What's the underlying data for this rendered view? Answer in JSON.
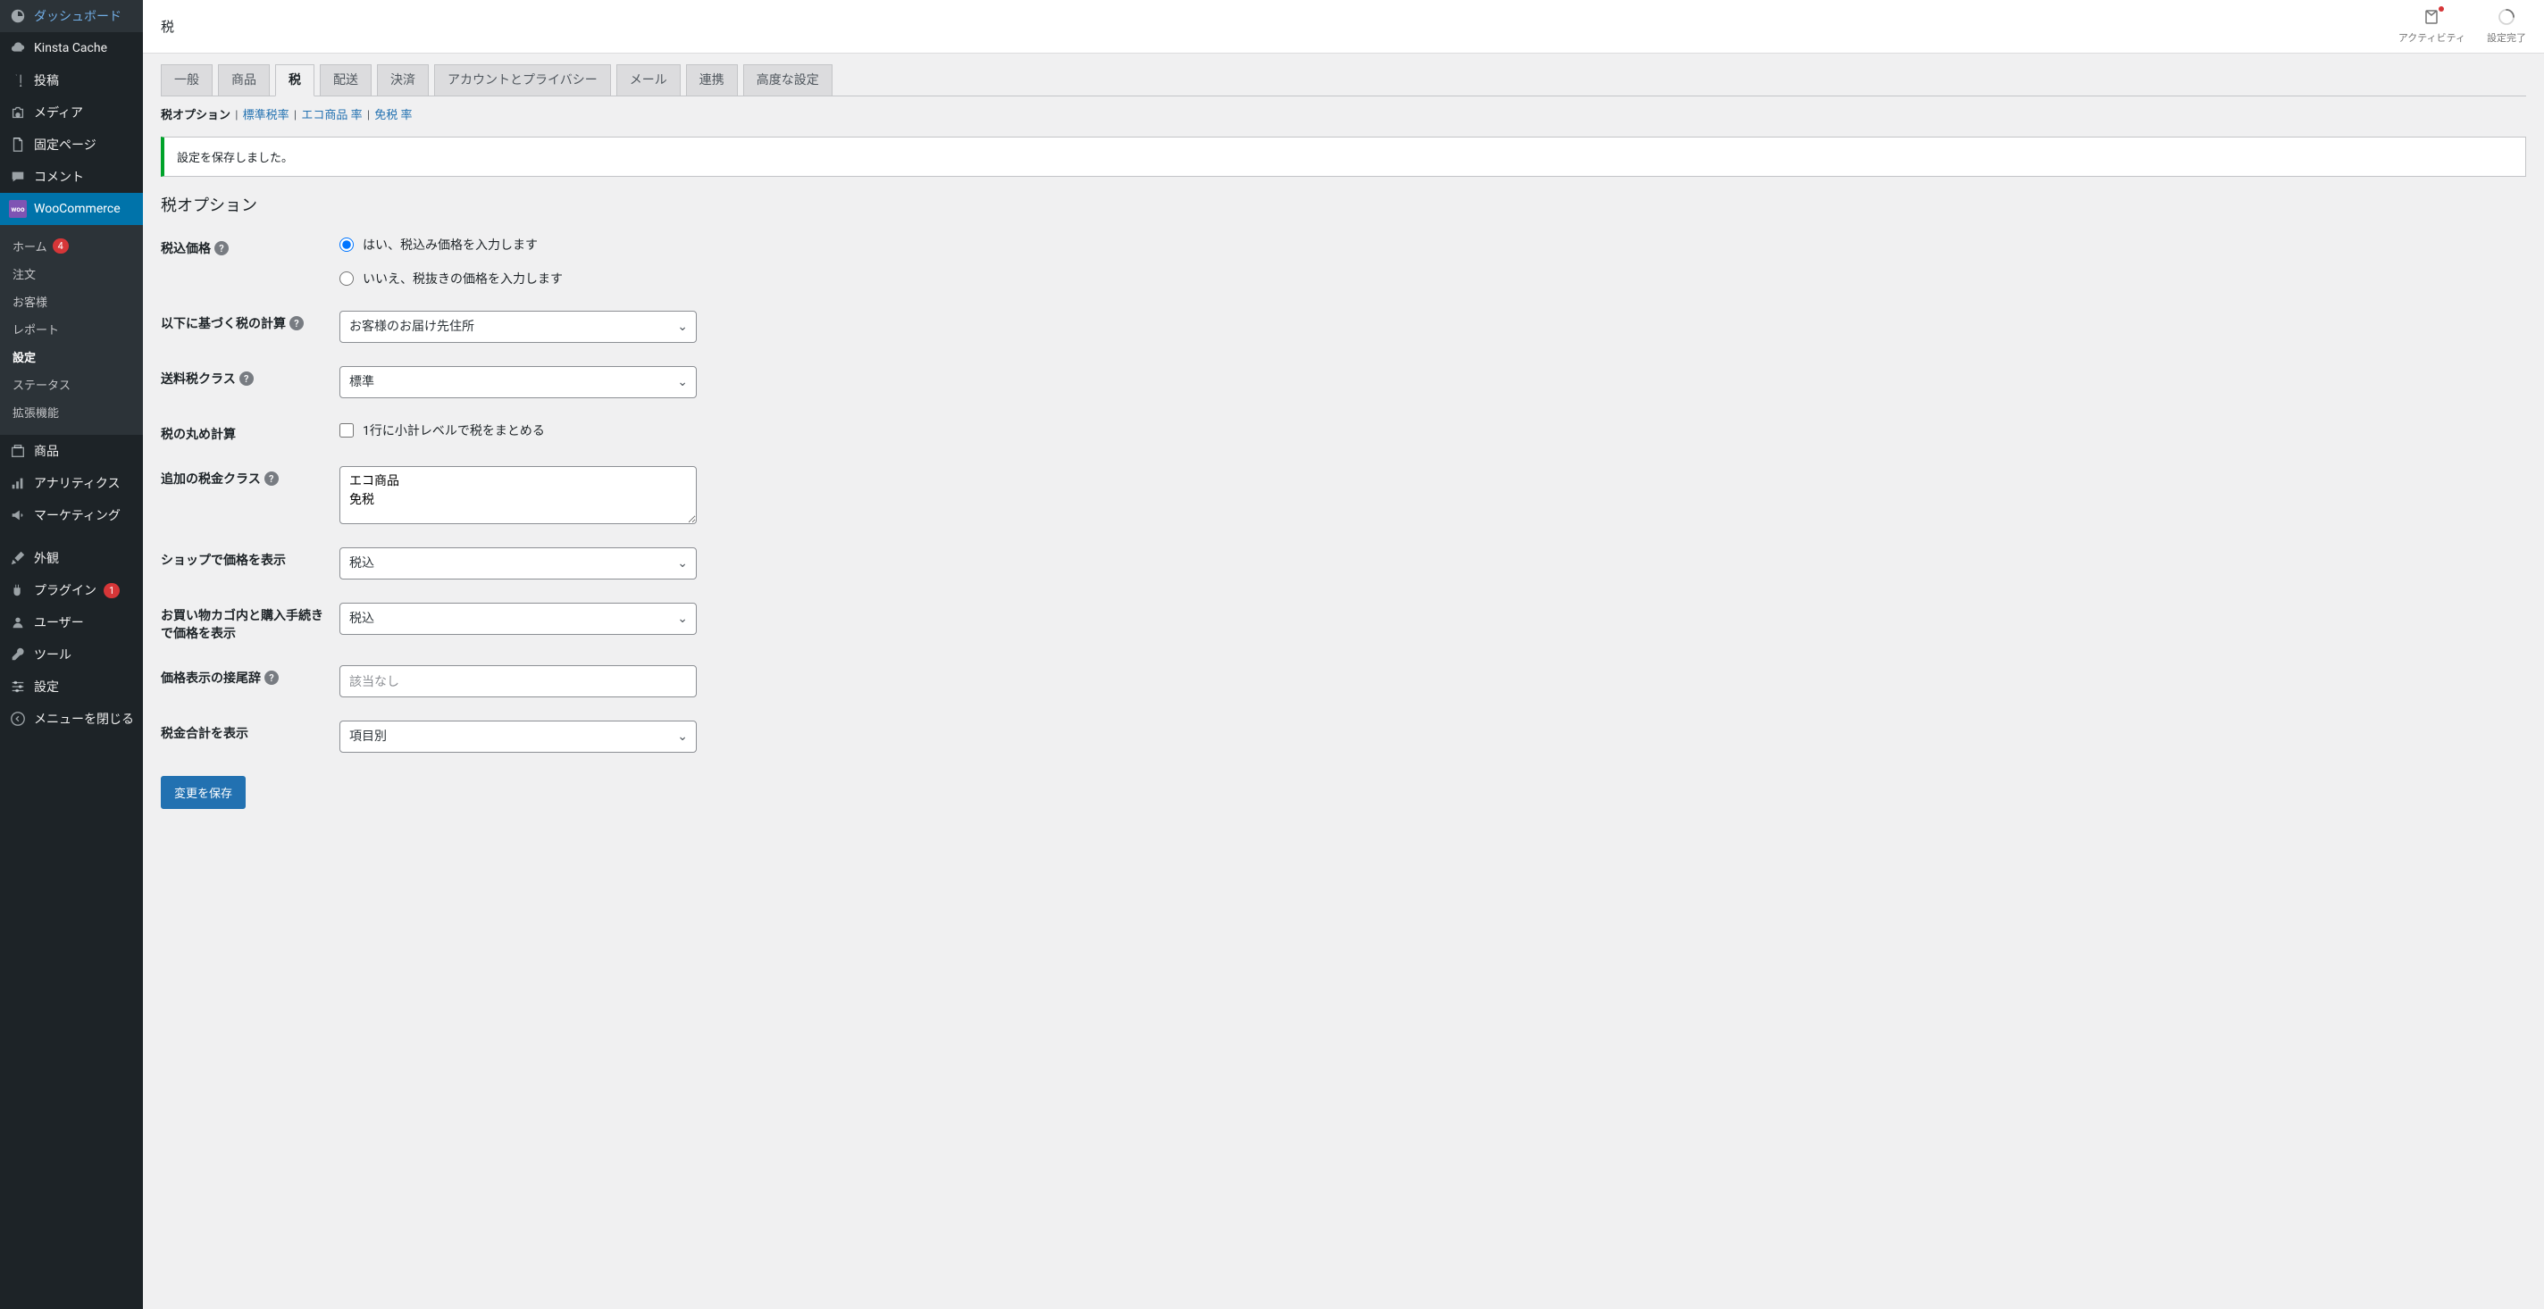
{
  "page_title": "税",
  "topbar": {
    "activity_label": "アクティビティ",
    "setup_label": "設定完了"
  },
  "sidebar": {
    "dashboard": "ダッシュボード",
    "kinsta": "Kinsta Cache",
    "posts": "投稿",
    "media": "メディア",
    "pages": "固定ページ",
    "comments": "コメント",
    "woocommerce": "WooCommerce",
    "products": "商品",
    "analytics": "アナリティクス",
    "marketing": "マーケティング",
    "appearance": "外観",
    "plugins": "プラグイン",
    "plugins_count": "1",
    "users": "ユーザー",
    "tools": "ツール",
    "settings": "設定",
    "collapse": "メニューを閉じる"
  },
  "woo_submenu": {
    "home": "ホーム",
    "home_count": "4",
    "orders": "注文",
    "customers": "お客様",
    "reports": "レポート",
    "settings": "設定",
    "status": "ステータス",
    "extensions": "拡張機能"
  },
  "tabs": {
    "general": "一般",
    "products": "商品",
    "tax": "税",
    "shipping": "配送",
    "payments": "決済",
    "accounts": "アカウントとプライバシー",
    "emails": "メール",
    "integration": "連携",
    "advanced": "高度な設定"
  },
  "subnav": {
    "options": "税オプション",
    "standard": "標準税率",
    "eco": "エコ商品 率",
    "exempt": "免税 率"
  },
  "notice_saved": "設定を保存しました。",
  "section_title": "税オプション",
  "form": {
    "prices_entered_with_tax_label": "税込価格",
    "radio_inclusive": "はい、税込み価格を入力します",
    "radio_exclusive": "いいえ、税抜きの価格を入力します",
    "calc_based_on_label": "以下に基づく税の計算",
    "calc_based_on_value": "お客様のお届け先住所",
    "shipping_tax_class_label": "送料税クラス",
    "shipping_tax_class_value": "標準",
    "rounding_label": "税の丸め計算",
    "rounding_checkbox": "1行に小計レベルで税をまとめる",
    "additional_classes_label": "追加の税金クラス",
    "additional_classes_value": "エコ商品\n免税",
    "display_shop_label": "ショップで価格を表示",
    "display_shop_value": "税込",
    "display_cart_label": "お買い物カゴ内と購入手続きで価格を表示",
    "display_cart_value": "税込",
    "suffix_label": "価格表示の接尾辞",
    "suffix_placeholder": "該当なし",
    "totals_label": "税金合計を表示",
    "totals_value": "項目別"
  },
  "submit_label": "変更を保存"
}
